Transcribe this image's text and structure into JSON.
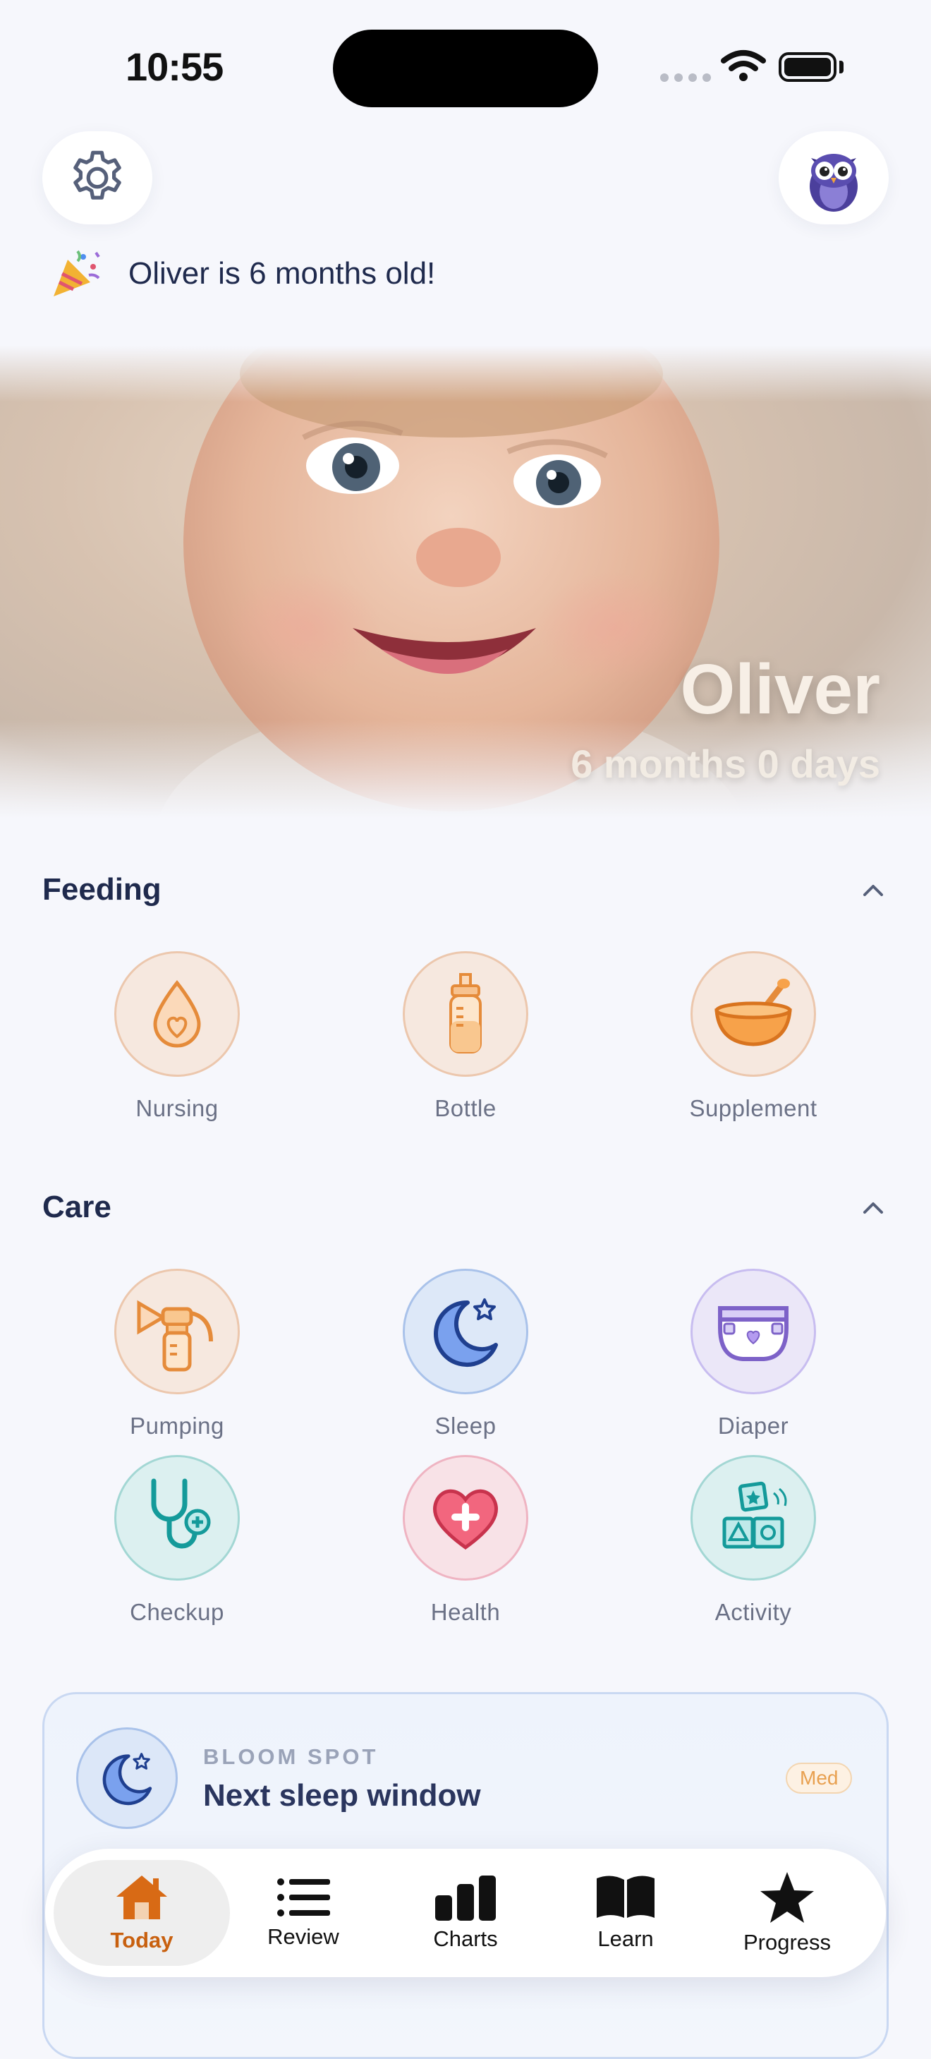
{
  "status_bar": {
    "time": "10:55"
  },
  "icons": {
    "settings": "gear-icon",
    "avatar": "owl-avatar-icon",
    "celebration": "party-popper-icon",
    "nursing": "drop-heart-icon",
    "bottle": "baby-bottle-icon",
    "supplement": "bowl-spoon-icon",
    "pumping": "breast-pump-icon",
    "sleep": "moon-star-icon",
    "diaper": "diaper-icon",
    "checkup": "stethoscope-icon",
    "health": "heart-plus-icon",
    "activity": "toy-blocks-icon",
    "tabs": [
      "home-icon",
      "list-icon",
      "bar-chart-icon",
      "book-icon",
      "star-icon"
    ]
  },
  "banner": {
    "text": "Oliver is 6 months old!"
  },
  "hero": {
    "name": "Oliver",
    "age": "6 months 0 days"
  },
  "feeding": {
    "title": "Feeding",
    "items": [
      {
        "label": "Nursing"
      },
      {
        "label": "Bottle"
      },
      {
        "label": "Supplement"
      }
    ]
  },
  "care": {
    "title": "Care",
    "items": [
      {
        "label": "Pumping"
      },
      {
        "label": "Sleep"
      },
      {
        "label": "Diaper"
      },
      {
        "label": "Checkup"
      },
      {
        "label": "Health"
      },
      {
        "label": "Activity"
      }
    ]
  },
  "bloom": {
    "kicker": "BLOOM SPOT",
    "title": "Next sleep window",
    "badge": "Med"
  },
  "tabs": [
    {
      "label": "Today",
      "active": true
    },
    {
      "label": "Review",
      "active": false
    },
    {
      "label": "Charts",
      "active": false
    },
    {
      "label": "Learn",
      "active": false
    },
    {
      "label": "Progress",
      "active": false
    }
  ],
  "colors": {
    "accent": "#c8600f",
    "text": "#1f2a4d",
    "muted": "#6b7186"
  }
}
